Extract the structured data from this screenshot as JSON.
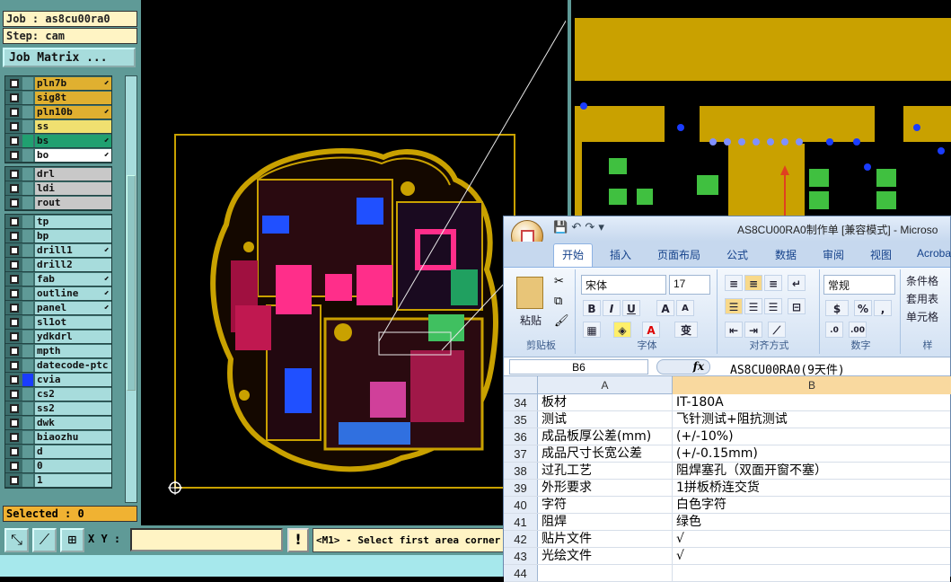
{
  "genesis": {
    "job": "Job : as8cu00ra0",
    "step": "Step: cam",
    "matrix_btn": "Job Matrix ...",
    "selected": "Selected : 0",
    "xy_label": "X Y :",
    "xy_value": "",
    "bang": "!",
    "message": "<M1> - Select first area corner",
    "layer_groups": [
      [
        {
          "name": "pln7b",
          "color": "#e0b030",
          "arrow": "⬋"
        },
        {
          "name": "sig8t",
          "color": "#e0b030",
          "arrow": ""
        },
        {
          "name": "pln10b",
          "color": "#e0b030",
          "arrow": "⬋"
        },
        {
          "name": "ss",
          "color": "#f0e070",
          "arrow": ""
        },
        {
          "name": "bs",
          "color": "#20a070",
          "arrow": "⬋",
          "swatch": "#20a070"
        },
        {
          "name": "bo",
          "color": "#ffffff",
          "arrow": "⬋"
        }
      ],
      [
        {
          "name": "drl",
          "color": "#c8c8c8",
          "arrow": ""
        },
        {
          "name": "ldi",
          "color": "#c8c8c8",
          "arrow": ""
        },
        {
          "name": "rout",
          "color": "#c8c8c8",
          "arrow": ""
        }
      ],
      [
        {
          "name": "tp",
          "color": "#a7dcdc",
          "arrow": ""
        },
        {
          "name": "bp",
          "color": "#a7dcdc",
          "arrow": ""
        },
        {
          "name": "drill1",
          "color": "#a7dcdc",
          "arrow": "⬋"
        },
        {
          "name": "drill2",
          "color": "#a7dcdc",
          "arrow": ""
        },
        {
          "name": "fab",
          "color": "#a7dcdc",
          "arrow": "⬋"
        },
        {
          "name": "outline",
          "color": "#a7dcdc",
          "arrow": "⬋"
        },
        {
          "name": "panel",
          "color": "#a7dcdc",
          "arrow": "⬋"
        },
        {
          "name": "sl1ot",
          "color": "#a7dcdc",
          "arrow": ""
        },
        {
          "name": "ydkdrl",
          "color": "#a7dcdc",
          "arrow": ""
        },
        {
          "name": "mpth",
          "color": "#a7dcdc",
          "arrow": ""
        },
        {
          "name": "datecode-ptc",
          "color": "#a7dcdc",
          "arrow": ""
        },
        {
          "name": "cvia",
          "color": "#a7dcdc",
          "arrow": "",
          "swatch": "#1a3cff"
        },
        {
          "name": "cs2",
          "color": "#a7dcdc",
          "arrow": ""
        },
        {
          "name": "ss2",
          "color": "#a7dcdc",
          "arrow": ""
        },
        {
          "name": "dwk",
          "color": "#a7dcdc",
          "arrow": ""
        },
        {
          "name": "biaozhu",
          "color": "#a7dcdc",
          "arrow": ""
        },
        {
          "name": "d",
          "color": "#a7dcdc",
          "arrow": ""
        },
        {
          "name": "0",
          "color": "#a7dcdc",
          "arrow": ""
        },
        {
          "name": "1",
          "color": "#a7dcdc",
          "arrow": ""
        }
      ]
    ]
  },
  "excel": {
    "title": "AS8CU00RA0制作单 [兼容模式] - Microso",
    "tabs": [
      "开始",
      "插入",
      "页面布局",
      "公式",
      "数据",
      "审阅",
      "视图",
      "Acroba"
    ],
    "font_name": "宋体",
    "font_size": "17",
    "number_format": "常规",
    "group_labels": [
      "剪贴板",
      "字体",
      "对齐方式",
      "数字",
      "样"
    ],
    "paste": "粘贴",
    "style_items": [
      "条件格",
      "套用表",
      "单元格"
    ],
    "bold": "B",
    "italic": "I",
    "underline": "U",
    "name_box": "B6",
    "fx": "fx",
    "formula": "AS8CU00RA0(9天件)",
    "col_a": "A",
    "col_b": "B",
    "rows": [
      {
        "n": "34",
        "a": "板材",
        "b": "IT-180A"
      },
      {
        "n": "35",
        "a": "测试",
        "b": "飞针测试+阻抗测试"
      },
      {
        "n": "36",
        "a": "成品板厚公差(mm)",
        "b": "(+/-10%)"
      },
      {
        "n": "37",
        "a": "成品尺寸长宽公差",
        "b": "(+/-0.15mm)"
      },
      {
        "n": "38",
        "a": "过孔工艺",
        "b": "阻焊塞孔（双面开窗不塞）"
      },
      {
        "n": "39",
        "a": "外形要求",
        "b": "1拼板桥连交货"
      },
      {
        "n": "40",
        "a": "字符",
        "b": "白色字符"
      },
      {
        "n": "41",
        "a": "阻焊",
        "b": "绿色"
      },
      {
        "n": "42",
        "a": "贴片文件",
        "b": "√"
      },
      {
        "n": "43",
        "a": "光绘文件",
        "b": "√"
      },
      {
        "n": "44",
        "a": "",
        "b": ""
      }
    ]
  },
  "colors": {
    "panel": "#5f9a97",
    "trace": "#c9a100",
    "accent": "#f0b232"
  }
}
